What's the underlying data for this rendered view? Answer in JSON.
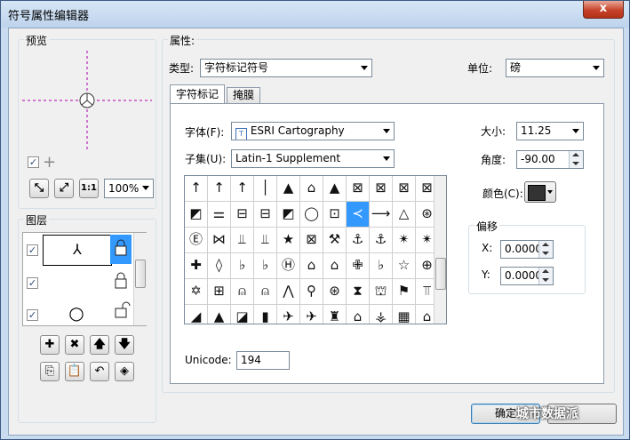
{
  "window": {
    "title": "符号属性编辑器",
    "close_label": "x"
  },
  "preview": {
    "label": "预览",
    "checkbox_checked": "✓",
    "toolbar": {
      "zoom_fit_symbol": "⤡",
      "zoom_extent_symbol": "⤢",
      "actual_size_label": "1:1"
    },
    "zoom_level": "100%"
  },
  "layers": {
    "label": "图层",
    "items": [
      {
        "checked": "✓",
        "lock_icon": "lock-icon",
        "preview_glyph": "⅄"
      },
      {
        "checked": "✓",
        "lock_icon": "lock-icon",
        "preview_glyph": ""
      },
      {
        "checked": "✓",
        "lock_icon": "lock-open-icon",
        "preview_glyph": "○"
      }
    ],
    "buttons": [
      "add-layer",
      "remove-layer",
      "move-up",
      "move-down",
      "copy-layer",
      "paste-layer",
      "undo-layer",
      "tag-layer"
    ]
  },
  "properties": {
    "label": "属性:",
    "type_label": "类型:",
    "type_value": "字符标记符号",
    "unit_label": "单位:",
    "unit_value": "磅",
    "tabs": [
      {
        "label": "字符标记"
      },
      {
        "label": "掩膜"
      }
    ],
    "font_label": "字体(F):",
    "font_value": "ESRI Cartography",
    "subset_label": "子集(U):",
    "subset_value": "Latin-1 Supplement",
    "size_label": "大小:",
    "size_value": "11.25",
    "angle_label": "角度:",
    "angle_value": "-90.00",
    "color_label": "颜色(C):",
    "color_swatch": "#333333",
    "offset_label": "偏移",
    "offset_x_label": "X:",
    "offset_x_value": "0.0000",
    "offset_y_label": "Y:",
    "offset_y_value": "0.0000",
    "unicode_label": "Unicode:",
    "unicode_value": "194",
    "glyphs": [
      [
        "↑",
        "↑",
        "↑",
        "│",
        "▲",
        "⌂",
        "▲",
        "⊠",
        "⊠",
        "⊠",
        "⊠"
      ],
      [
        "◩",
        "⚌",
        "⊟",
        "⊟",
        "◩",
        "◯",
        "⊡",
        "≺",
        "⟶",
        "△",
        "⊛"
      ],
      [
        "Ⓔ",
        "⋈",
        "⫫",
        "⫫",
        "★",
        "⊠",
        "⚒",
        "⚓",
        "⚓",
        "✴",
        "✴"
      ],
      [
        "✚",
        "◊",
        "♭",
        "♭",
        "Ⓗ",
        "⌂",
        "⌂",
        "✙",
        "♭",
        "☆",
        "⊕"
      ],
      [
        "✡",
        "⊞",
        "⍝",
        "⍝",
        "⋀",
        "⚲",
        "⊛",
        "⧗",
        "⛫",
        "⚑",
        "⫪"
      ],
      [
        "◢",
        "▲",
        "◪",
        "▮",
        "✈",
        "✈",
        "♜",
        "⌂",
        "⚶",
        "▦",
        "⌂"
      ]
    ],
    "selected_glyph_row": 1,
    "selected_glyph_col": 7
  },
  "footer": {
    "ok_label": "确定"
  },
  "watermark": "城市数据派"
}
